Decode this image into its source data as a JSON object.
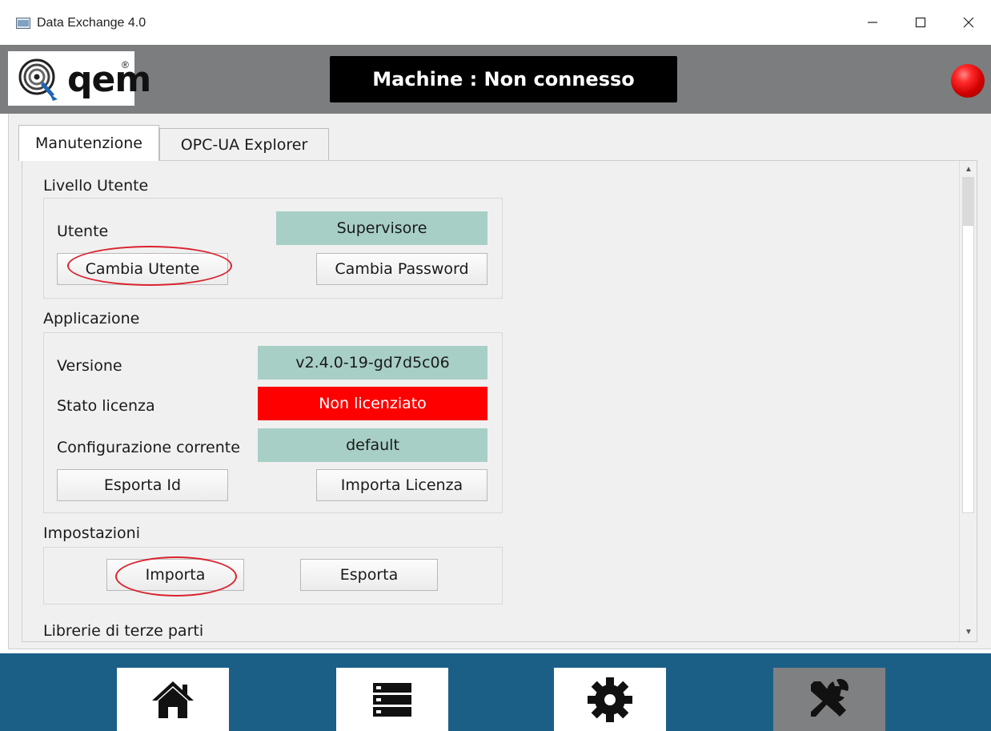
{
  "window": {
    "title": "Data Exchange 4.0",
    "controls": [
      "minimize-icon",
      "maximize-icon",
      "close-icon"
    ]
  },
  "header": {
    "logo_text": "qem",
    "logo_mark": "®",
    "machine_status": "Machine : Non connesso",
    "status_led_color": "#e00000"
  },
  "tabs": [
    {
      "label": "Manutenzione",
      "active": true
    },
    {
      "label": "OPC-UA Explorer",
      "active": false
    }
  ],
  "livello_utente": {
    "title": "Livello Utente",
    "utente_label": "Utente",
    "utente_value": "Supervisore",
    "cambia_utente": "Cambia Utente",
    "cambia_password": "Cambia Password"
  },
  "applicazione": {
    "title": "Applicazione",
    "versione_label": "Versione",
    "versione_value": "v2.4.0-19-gd7d5c06",
    "stato_label": "Stato licenza",
    "stato_value": "Non licenziato",
    "config_label": "Configurazione corrente",
    "config_value": "default",
    "esporta_id": "Esporta Id",
    "importa_licenza": "Importa Licenza"
  },
  "impostazioni": {
    "title": "Impostazioni",
    "importa": "Importa",
    "esporta": "Esporta"
  },
  "librerie": {
    "title": "Librerie di terze parti"
  },
  "footer": {
    "buttons": [
      "home-icon",
      "list-icon",
      "gear-icon",
      "tools-icon"
    ],
    "selected": "tools-icon"
  },
  "colors": {
    "value_bg": "#a7cfc6",
    "error_bg": "#ff0000",
    "footer_bg": "#1c5f86",
    "header_bg": "#7b7d7f",
    "highlight_ellipse": "#d9232e"
  }
}
